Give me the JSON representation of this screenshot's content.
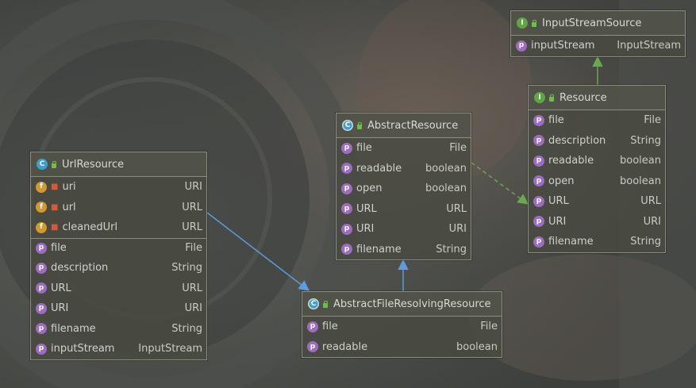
{
  "diagram": {
    "nodes": {
      "input_stream_source": {
        "kind": "interface",
        "badge": "I",
        "title": "InputStreamSource",
        "rows": [
          {
            "badge": "p",
            "name": "inputStream",
            "type": "InputStream"
          }
        ]
      },
      "resource": {
        "kind": "interface",
        "badge": "I",
        "title": "Resource",
        "rows": [
          {
            "badge": "p",
            "name": "file",
            "type": "File"
          },
          {
            "badge": "p",
            "name": "description",
            "type": "String"
          },
          {
            "badge": "p",
            "name": "readable",
            "type": "boolean"
          },
          {
            "badge": "p",
            "name": "open",
            "type": "boolean"
          },
          {
            "badge": "p",
            "name": "URL",
            "type": "URL"
          },
          {
            "badge": "p",
            "name": "URI",
            "type": "URI"
          },
          {
            "badge": "p",
            "name": "filename",
            "type": "String"
          }
        ]
      },
      "abstract_resource": {
        "kind": "abstract-class",
        "badge": "C",
        "title": "AbstractResource",
        "rows": [
          {
            "badge": "p",
            "name": "file",
            "type": "File"
          },
          {
            "badge": "p",
            "name": "readable",
            "type": "boolean"
          },
          {
            "badge": "p",
            "name": "open",
            "type": "boolean"
          },
          {
            "badge": "p",
            "name": "URL",
            "type": "URL"
          },
          {
            "badge": "p",
            "name": "URI",
            "type": "URI"
          },
          {
            "badge": "p",
            "name": "filename",
            "type": "String"
          }
        ]
      },
      "url_resource": {
        "kind": "class",
        "badge": "C",
        "title": "UrlResource",
        "fields": [
          {
            "badge": "f",
            "name": "uri",
            "type": "URI"
          },
          {
            "badge": "f",
            "name": "url",
            "type": "URL"
          },
          {
            "badge": "f",
            "name": "cleanedUrl",
            "type": "URL"
          }
        ],
        "rows": [
          {
            "badge": "p",
            "name": "file",
            "type": "File"
          },
          {
            "badge": "p",
            "name": "description",
            "type": "String"
          },
          {
            "badge": "p",
            "name": "URL",
            "type": "URL"
          },
          {
            "badge": "p",
            "name": "URI",
            "type": "URI"
          },
          {
            "badge": "p",
            "name": "filename",
            "type": "String"
          },
          {
            "badge": "p",
            "name": "inputStream",
            "type": "InputStream"
          }
        ]
      },
      "abstract_file_resolving_resource": {
        "kind": "abstract-class",
        "badge": "C",
        "title": "AbstractFileResolvingResource",
        "rows": [
          {
            "badge": "p",
            "name": "file",
            "type": "File"
          },
          {
            "badge": "p",
            "name": "readable",
            "type": "boolean"
          }
        ]
      }
    },
    "edges": [
      {
        "from": "resource",
        "to": "input_stream_source",
        "style": "extends"
      },
      {
        "from": "abstract_resource",
        "to": "resource",
        "style": "implements"
      },
      {
        "from": "abstract_file_resolving_resource",
        "to": "abstract_resource",
        "style": "extends"
      },
      {
        "from": "url_resource",
        "to": "abstract_file_resolving_resource",
        "style": "extends"
      }
    ],
    "colors": {
      "extends_green": "#6aa84f",
      "extends_blue": "#5b9be0",
      "implements_green": "#6aa84f",
      "class_badge": "#3e9fd0",
      "interface_badge": "#5fa546",
      "field_badge": "#d09a2e",
      "property_badge": "#9d6cc0"
    }
  }
}
